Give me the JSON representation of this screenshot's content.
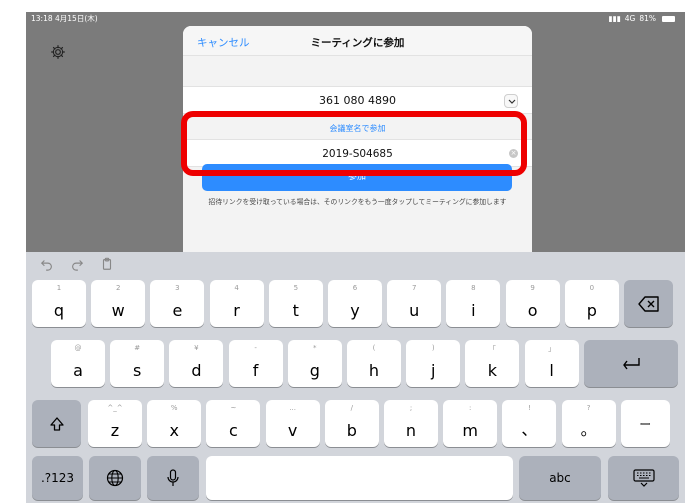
{
  "status": {
    "time_date": "13:18  4月15日(木)",
    "signal": "4G",
    "battery": "81%"
  },
  "dialog": {
    "cancel_label": "キャンセル",
    "title": "ミーティングに参加",
    "meeting_id": "361 080 4890",
    "personal_link_label": "会議室名で参加",
    "name_value": "2019-S04685",
    "join_label": "参加",
    "note": "招待リンクを受け取っている場合は、そのリンクをもう一度タップしてミーティングに参加します"
  },
  "keyboard": {
    "row1": [
      {
        "hint": "1",
        "main": "q"
      },
      {
        "hint": "2",
        "main": "w"
      },
      {
        "hint": "3",
        "main": "e"
      },
      {
        "hint": "4",
        "main": "r"
      },
      {
        "hint": "5",
        "main": "t"
      },
      {
        "hint": "6",
        "main": "y"
      },
      {
        "hint": "7",
        "main": "u"
      },
      {
        "hint": "8",
        "main": "i"
      },
      {
        "hint": "9",
        "main": "o"
      },
      {
        "hint": "0",
        "main": "p"
      }
    ],
    "row2": [
      {
        "hint": "@",
        "main": "a"
      },
      {
        "hint": "#",
        "main": "s"
      },
      {
        "hint": "¥",
        "main": "d"
      },
      {
        "hint": "-",
        "main": "f"
      },
      {
        "hint": "*",
        "main": "g"
      },
      {
        "hint": "(",
        "main": "h"
      },
      {
        "hint": ")",
        "main": "j"
      },
      {
        "hint": "「",
        "main": "k"
      },
      {
        "hint": "」",
        "main": "l"
      }
    ],
    "row3": [
      {
        "hint": "^_^",
        "main": "z"
      },
      {
        "hint": "%",
        "main": "x"
      },
      {
        "hint": "~",
        "main": "c"
      },
      {
        "hint": "...",
        "main": "v"
      },
      {
        "hint": "/",
        "main": "b"
      },
      {
        "hint": ";",
        "main": "n"
      },
      {
        "hint": ":",
        "main": "m"
      },
      {
        "hint": "!",
        "main": "、"
      },
      {
        "hint": "?",
        "main": "。"
      }
    ],
    "dash_label": "ー",
    "numbers_label": ".?123",
    "abc_label": "abc"
  }
}
